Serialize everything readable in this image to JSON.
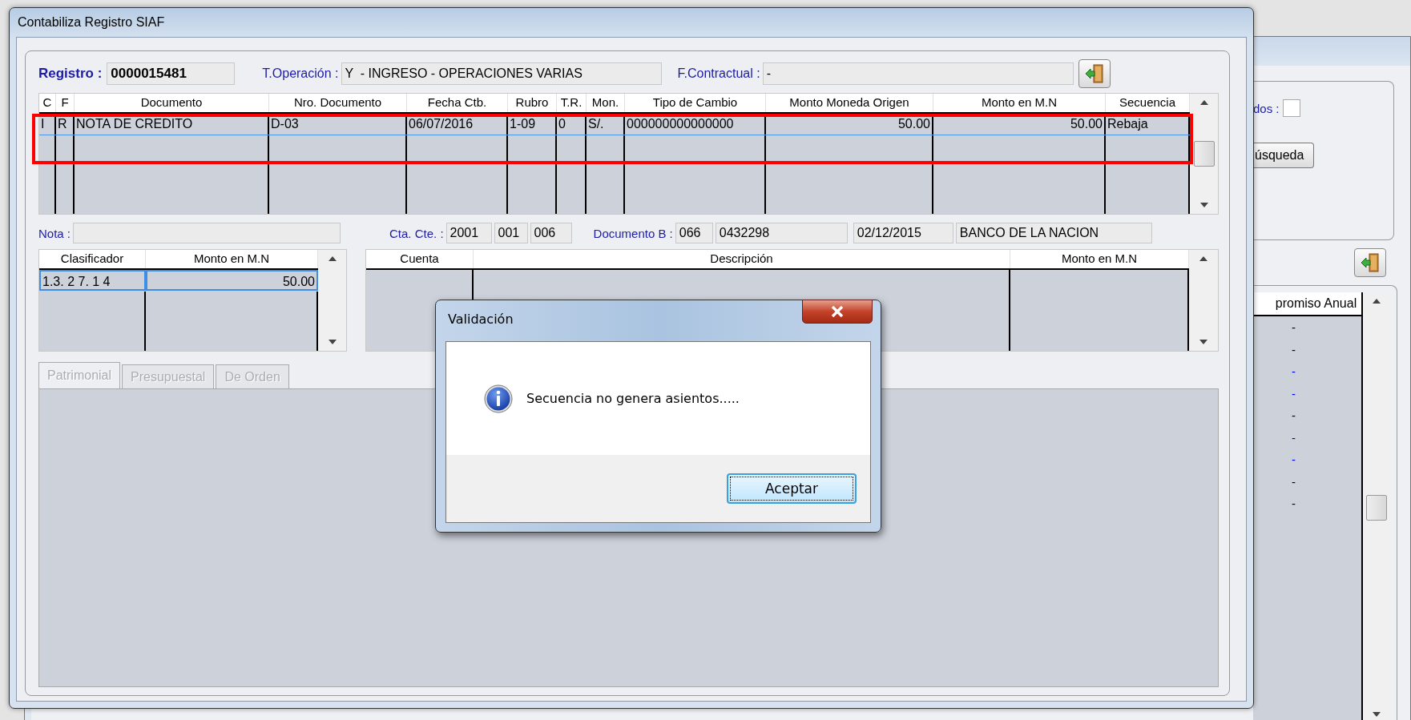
{
  "window": {
    "title": "Contabiliza Registro SIAF"
  },
  "header": {
    "registro_label": "Registro :",
    "registro": "0000015481",
    "operacion_label": "T.Operación :",
    "operacion": "Y  - INGRESO - OPERACIONES VARIAS",
    "contractual_label": "F.Contractual :",
    "contractual": "-"
  },
  "documents_table": {
    "columns": [
      "C",
      "F",
      "Documento",
      "Nro. Documento",
      "Fecha Ctb.",
      "Rubro",
      "T.R.",
      "Mon.",
      "Tipo de Cambio",
      "Monto Moneda Origen",
      "Monto en M.N",
      "Secuencia"
    ],
    "rows": [
      {
        "selected": true,
        "cells": [
          "I",
          "R",
          "NOTA DE CREDITO",
          "D-03",
          "06/07/2016",
          "1-09",
          "0",
          "S/.",
          "000000000000000",
          "50.00",
          "50.00",
          "Rebaja"
        ]
      }
    ]
  },
  "details": {
    "nota_label": "Nota :",
    "cta_label": "Cta. Cte. :",
    "cta": [
      "2001",
      "001",
      "006"
    ],
    "documento_b_label": "Documento B :",
    "documento_b": [
      "066",
      "0432298",
      "02/12/2015",
      "BANCO DE LA NACION"
    ]
  },
  "classifier_table": {
    "columns": [
      "Clasificador",
      "Monto en M.N"
    ],
    "rows": [
      {
        "selected": true,
        "cells": [
          "1.3. 2 7. 1 4",
          "50.00"
        ]
      }
    ]
  },
  "accounts_table": {
    "columns": [
      "Cuenta",
      "Descripción",
      "Monto en M.N"
    ]
  },
  "tabs": [
    {
      "label": "Patrimonial",
      "selected": true,
      "disabled": true
    },
    {
      "label": "Presupuestal",
      "selected": false,
      "disabled": true
    },
    {
      "label": "De Orden",
      "selected": false,
      "disabled": true
    }
  ],
  "dialog": {
    "title": "Validación",
    "message": "Secuencia no genera asientos.....",
    "button": "Aceptar"
  },
  "background_window": {
    "checkbox_label": "dos :",
    "checked": false,
    "search_button": "úsqueda",
    "table_column": "promiso Anual",
    "rows": [
      {
        "value": "-",
        "color": "#000000"
      },
      {
        "value": "-",
        "color": "#000000"
      },
      {
        "value": "-",
        "color": "#0000ff"
      },
      {
        "value": "-",
        "color": "#0000ff"
      },
      {
        "value": "-",
        "color": "#000000"
      },
      {
        "value": "-",
        "color": "#0000ff"
      },
      {
        "value": "-",
        "color": "#0000ff"
      },
      {
        "value": "-",
        "color": "#000000"
      },
      {
        "value": "-",
        "color": "#000000"
      }
    ]
  }
}
